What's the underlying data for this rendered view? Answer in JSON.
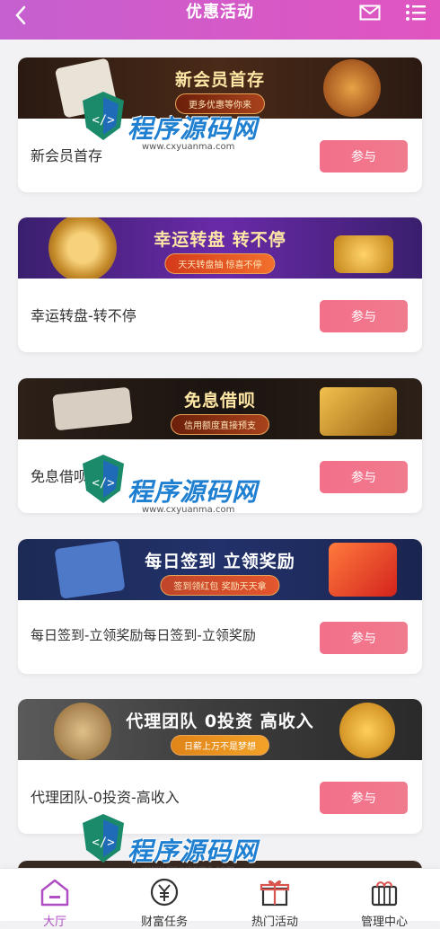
{
  "header": {
    "title": "优惠活动",
    "back_icon": "chevron-left-icon",
    "mail_icon": "mail-icon",
    "menu_icon": "list-menu-icon"
  },
  "promotions": [
    {
      "banner_title": "新会员首存",
      "banner_subtitle": "更多优惠等你来",
      "label": "新会员首存",
      "button": "参与"
    },
    {
      "banner_title": "幸运转盘 转不停",
      "banner_subtitle": "天天转盘抽 惊喜不停",
      "label": "幸运转盘-转不停",
      "button": "参与"
    },
    {
      "banner_title": "免息借呗",
      "banner_subtitle": "信用额度直接预支",
      "label": "免息借呗",
      "button": "参与"
    },
    {
      "banner_title": "每日签到 立领奖励",
      "banner_subtitle": "签到领红包 奖励天天拿",
      "label": "每日签到-立领奖励每日签到-立领奖励",
      "button": "参与"
    },
    {
      "banner_title": "代理团队 0投资 高收入",
      "banner_subtitle": "日薪上万不是梦想",
      "label": "代理团队-0投资-高收入",
      "button": "参与"
    }
  ],
  "tabbar": [
    {
      "label": "大厅",
      "icon": "home-icon",
      "active": true
    },
    {
      "label": "财富任务",
      "icon": "yuan-coin-icon",
      "active": false
    },
    {
      "label": "热门活动",
      "icon": "gift-icon",
      "active": false
    },
    {
      "label": "管理中心",
      "icon": "gift-box-icon",
      "active": false
    }
  ],
  "watermark": {
    "text": "程序源码网",
    "url": "www.cxyuanma.com"
  },
  "colors": {
    "header_start": "#c560d0",
    "header_end": "#e055c0",
    "button": "#f36f8a",
    "active_tab": "#b04fc4"
  }
}
